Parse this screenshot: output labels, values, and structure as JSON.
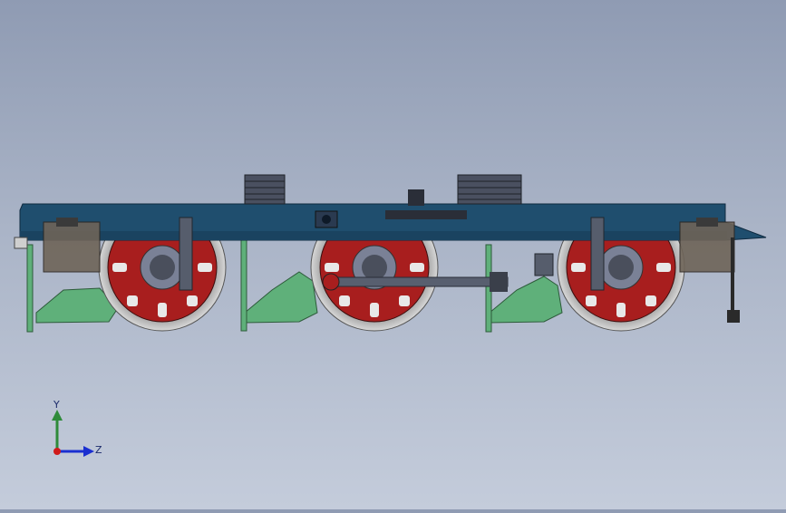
{
  "viewport": {
    "model": "locomotive-bogie-assembly",
    "colors": {
      "background_top": "#8f9bb3",
      "background_bottom": "#c4ccdb",
      "frame": "#1f4e6e",
      "wheel_rim": "#b0b0b0",
      "wheel_center": "#a81e1e",
      "suspension": "#5fb07a",
      "axlebox": "#7a8196"
    }
  },
  "triad": {
    "y_label": "Y",
    "z_label": "Z",
    "y_color": "#2e8b3a",
    "z_color": "#1a2fd0",
    "origin_color": "#d01a1a"
  }
}
